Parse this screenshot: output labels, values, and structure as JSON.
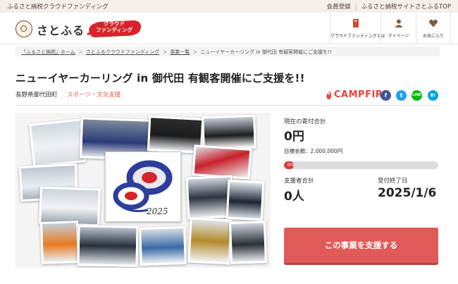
{
  "topbar": {
    "site_label": "ふるさと納税クラウドファンディング",
    "links": [
      "会員登録",
      "ふるさと納税サイトさとふるTOP"
    ]
  },
  "header": {
    "logo_text": "さとふる",
    "badge_text": "クラウド\nファンディング",
    "nav": [
      {
        "label": "クラウドファンディングとは",
        "icon": "book-icon"
      },
      {
        "label": "マイページ",
        "icon": "user-icon"
      },
      {
        "label": "お気に入り",
        "icon": "heart-icon"
      }
    ]
  },
  "breadcrumb": {
    "items": [
      "「ふるさと納税」ホーム",
      "さとふるクラウドファンディング",
      "事業一覧",
      "ニューイヤーカーリング in 御代田 有観客開催にご支援を!!"
    ]
  },
  "project": {
    "title": "ニューイヤーカーリング in 御代田 有観客開催にご支援を!!",
    "location": "長野県御代田町",
    "category": "スポーツ・文化支援",
    "partner": "CAMPFIRE"
  },
  "social": {
    "facebook": "f",
    "twitter": "t",
    "line": "LINE",
    "hatena": "B!"
  },
  "stats": {
    "current_label": "現在の寄付合計",
    "current_value": "0円",
    "goal_text": "目標金額：2,000,000円",
    "progress_label": "0%",
    "progress_value": 0,
    "supporters_label": "支援者合計",
    "supporters_value": "0人",
    "deadline_label": "受付終了日",
    "deadline_value": "2025/1/6"
  },
  "hero": {
    "logo_year": "2025"
  },
  "cta": {
    "label": "この事業を支援する"
  },
  "colors": {
    "accent": "#e15a5a",
    "category": "#e06052",
    "topbar_bg": "#f6efe7"
  }
}
